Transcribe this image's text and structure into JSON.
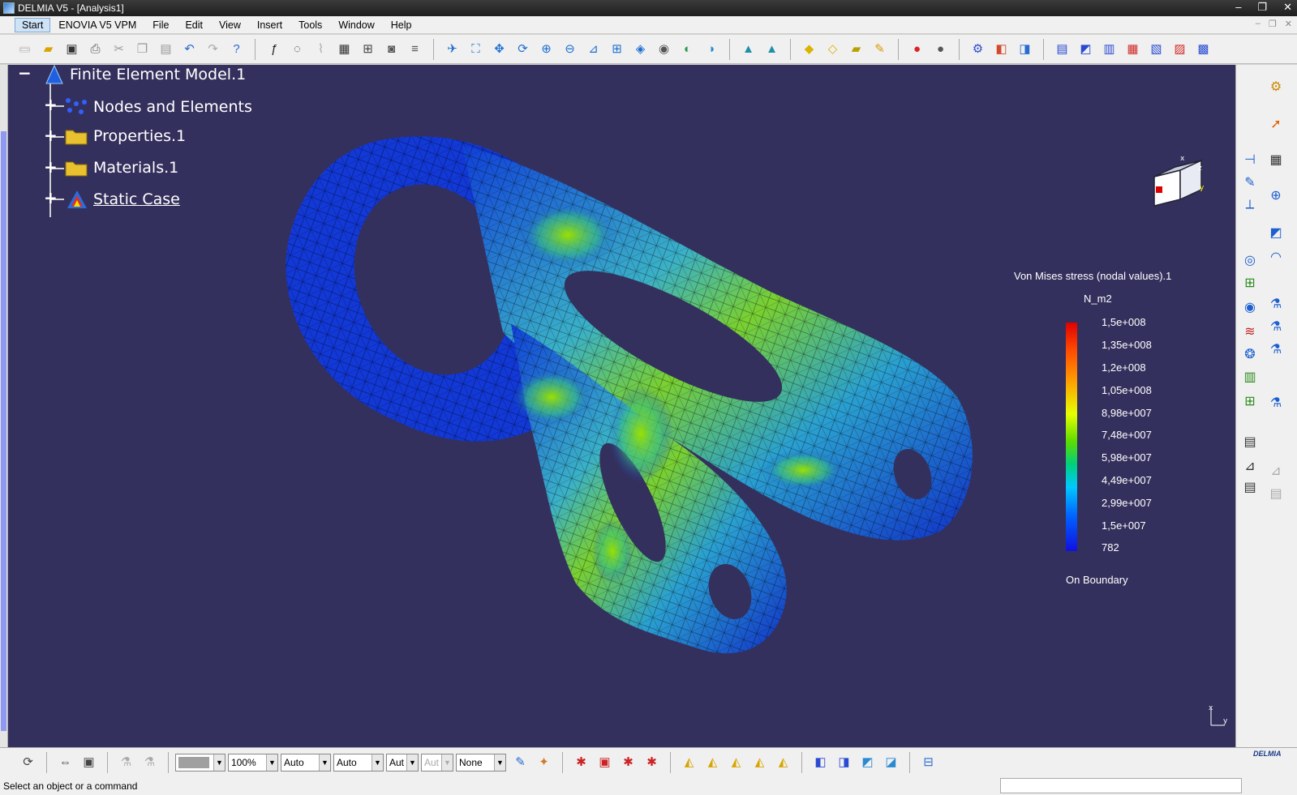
{
  "window": {
    "title": "DELMIA V5 - [Analysis1]",
    "controls": [
      "–",
      "❐",
      "✕"
    ]
  },
  "menu": {
    "start": "Start",
    "items": [
      "ENOVIA V5 VPM",
      "File",
      "Edit",
      "View",
      "Insert",
      "Tools",
      "Window",
      "Help"
    ]
  },
  "tree": {
    "root": "Finite Element Model.1",
    "children": [
      "Nodes and Elements",
      "Properties.1",
      "Materials.1",
      "Static Case"
    ]
  },
  "legend": {
    "title": "Von Mises stress (nodal values).1",
    "unit": "N_m2",
    "ticks": [
      "1,5e+008",
      "1,35e+008",
      "1,2e+008",
      "1,05e+008",
      "8,98e+007",
      "7,48e+007",
      "5,98e+007",
      "4,49e+007",
      "2,99e+007",
      "1,5e+007",
      "782"
    ],
    "footer": "On Boundary"
  },
  "bottom_toolbar": {
    "color_value": "",
    "zoom": "100%",
    "auto1": "Auto",
    "auto2": "Auto",
    "auto3": "Aut",
    "auto4": "Aut",
    "none": "None"
  },
  "status": {
    "message": "Select an object or a command"
  },
  "brand": "DELMIA",
  "colors": {
    "viewport_bg": "#34305d",
    "chrome": "#f0f0f0"
  }
}
